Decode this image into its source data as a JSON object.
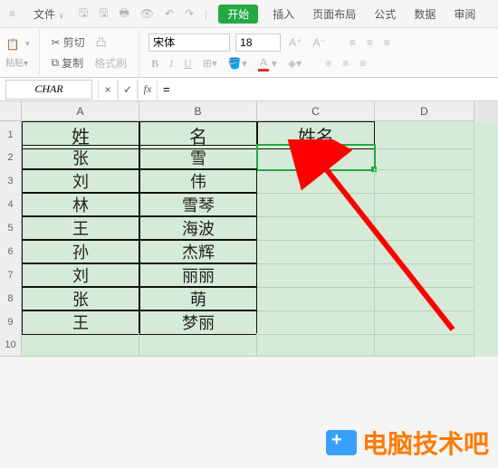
{
  "menu": {
    "hamburger": "≡",
    "file": "文件",
    "start_tab": "开始",
    "insert": "插入",
    "page_layout": "页面布局",
    "formulas": "公式",
    "data": "数据",
    "review": "审阅"
  },
  "clipboard": {
    "cut": "剪切",
    "copy": "复制",
    "format_painter": "格式刷"
  },
  "font": {
    "name": "宋体",
    "size": "18",
    "bold": "B",
    "italic": "I",
    "underline": "U",
    "strike": "A"
  },
  "formula_bar": {
    "name_box": "CHAR",
    "cancel": "×",
    "confirm": "✓",
    "fx": "fx",
    "value": "="
  },
  "columns": [
    "",
    "A",
    "B",
    "C",
    "D"
  ],
  "row_count": 10,
  "table": {
    "headers": {
      "a": "姓",
      "b": "名",
      "c": "姓名"
    },
    "rows": [
      {
        "a": "张",
        "b": "雪",
        "c": "="
      },
      {
        "a": "刘",
        "b": "伟",
        "c": ""
      },
      {
        "a": "林",
        "b": "雪琴",
        "c": ""
      },
      {
        "a": "王",
        "b": "海波",
        "c": ""
      },
      {
        "a": "孙",
        "b": "杰辉",
        "c": ""
      },
      {
        "a": "刘",
        "b": "丽丽",
        "c": ""
      },
      {
        "a": "张",
        "b": "萌",
        "c": ""
      },
      {
        "a": "王",
        "b": "梦丽",
        "c": ""
      }
    ]
  },
  "active_cell": "C2",
  "watermark": "电脑技术吧"
}
